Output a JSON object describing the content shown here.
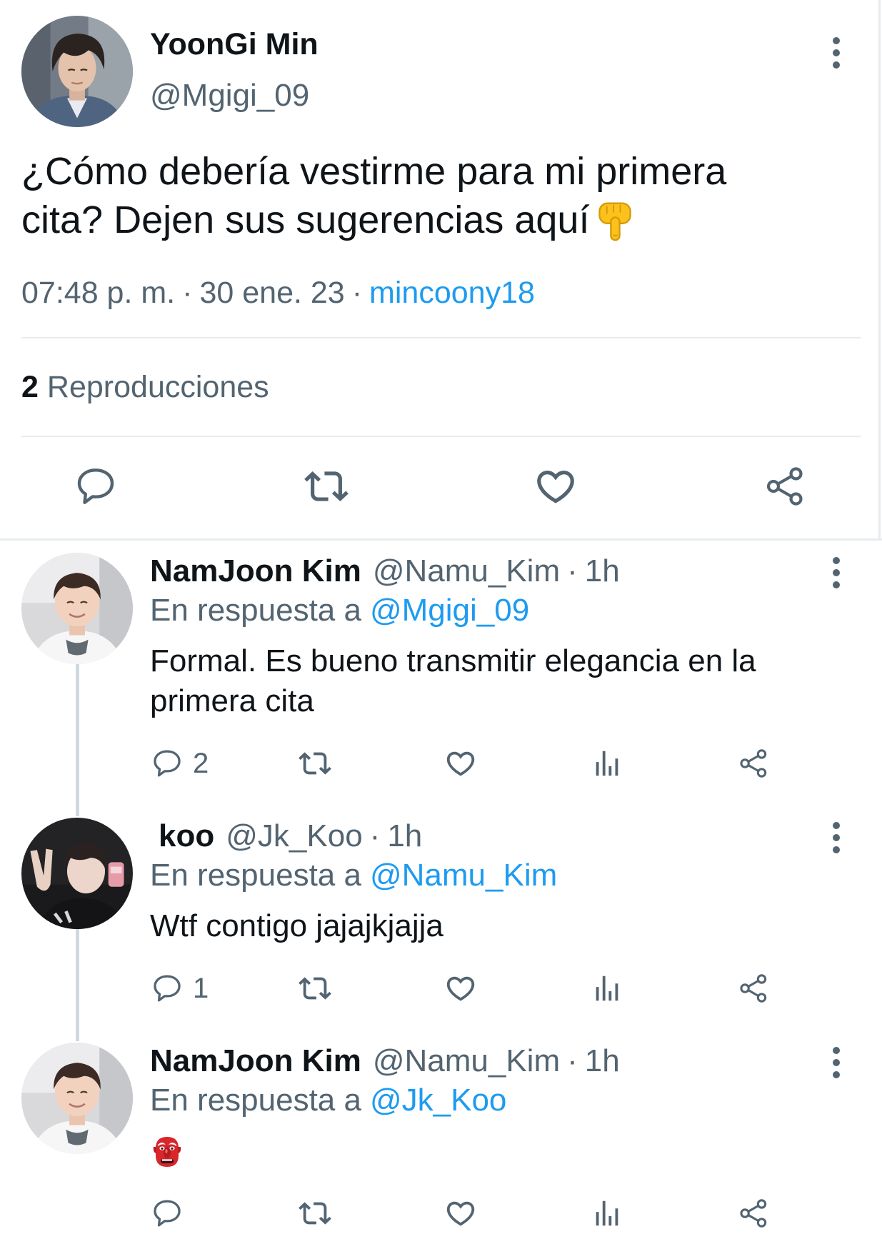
{
  "colors": {
    "text": "#0f1419",
    "secondary": "#536471",
    "accent": "#1d9bf0",
    "divider": "#e7ecef",
    "thread": "#cfd9de"
  },
  "separator": "·",
  "tweet": {
    "author": {
      "name": "YoonGi Min",
      "handle": "@Mgigi_09"
    },
    "text": "¿Cómo debería vestirme para mi primera cita? Dejen sus sugerencias aquí",
    "emoji_icon": "backhand-index-pointing-down-emoji",
    "time": "07:48 p. m.",
    "date": "30 ene. 23",
    "source": "mincoony18",
    "views": {
      "count": "2",
      "label": "Reproducciones"
    },
    "actions": [
      "reply-icon",
      "retweet-icon",
      "like-icon",
      "share-icon"
    ],
    "menu_icon": "more-vertical-icon"
  },
  "replies": [
    {
      "name": "NamJoon Kim",
      "handle": "@Namu_Kim",
      "time": "1h",
      "reply_prefix": "En respuesta a",
      "reply_to": "@Mgigi_09",
      "text": "Formal. Es bueno transmitir elegancia en la primera cita",
      "reply_count": "2",
      "actions": [
        "reply-icon",
        "retweet-icon",
        "like-icon",
        "views-icon",
        "share-icon"
      ]
    },
    {
      "name": "koo",
      "handle": "@Jk_Koo",
      "time": "1h",
      "reply_prefix": "En respuesta a",
      "reply_to": "@Namu_Kim",
      "text": "Wtf contigo jajajkjajja",
      "reply_count": "1",
      "actions": [
        "reply-icon",
        "retweet-icon",
        "like-icon",
        "views-icon",
        "share-icon"
      ]
    },
    {
      "name": "NamJoon Kim",
      "handle": "@Namu_Kim",
      "time": "1h",
      "reply_prefix": "En respuesta a",
      "reply_to": "@Jk_Koo",
      "emoji_icon": "japanese-goblin-emoji",
      "actions": [
        "reply-icon",
        "retweet-icon",
        "like-icon",
        "views-icon",
        "share-icon"
      ]
    }
  ]
}
